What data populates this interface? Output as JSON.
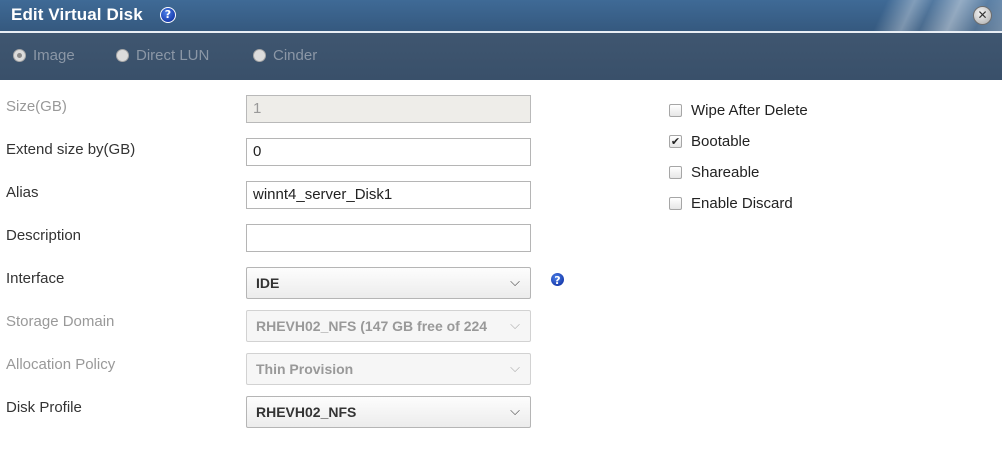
{
  "dialog": {
    "title": "Edit Virtual Disk",
    "help_glyph": "?",
    "close_glyph": "✕"
  },
  "disk_type": {
    "options": [
      {
        "label": "Image",
        "selected": true
      },
      {
        "label": "Direct LUN",
        "selected": false
      },
      {
        "label": "Cinder",
        "selected": false
      }
    ]
  },
  "form": {
    "size": {
      "label": "Size(GB)",
      "value": "1"
    },
    "extend": {
      "label": "Extend size by(GB)",
      "value": "0"
    },
    "alias": {
      "label": "Alias",
      "value": "winnt4_server_Disk1"
    },
    "description": {
      "label": "Description",
      "value": ""
    },
    "interface": {
      "label": "Interface",
      "value": "IDE",
      "help_glyph": "?"
    },
    "storage_domain": {
      "label": "Storage Domain",
      "value": "RHEVH02_NFS (147 GB free of 224"
    },
    "allocation_policy": {
      "label": "Allocation Policy",
      "value": "Thin Provision"
    },
    "disk_profile": {
      "label": "Disk Profile",
      "value": "RHEVH02_NFS"
    },
    "chevron_glyph": "⌵"
  },
  "options": {
    "wipe_after_delete": {
      "label": "Wipe After Delete",
      "checked": false
    },
    "bootable": {
      "label": "Bootable",
      "checked": true,
      "check_glyph": "✔"
    },
    "shareable": {
      "label": "Shareable",
      "checked": false
    },
    "enable_discard": {
      "label": "Enable Discard",
      "checked": false
    }
  },
  "colors": {
    "header_bg": "#3a6590",
    "typebar_bg": "#3c5470",
    "help_blue": "#1b3fb0"
  }
}
